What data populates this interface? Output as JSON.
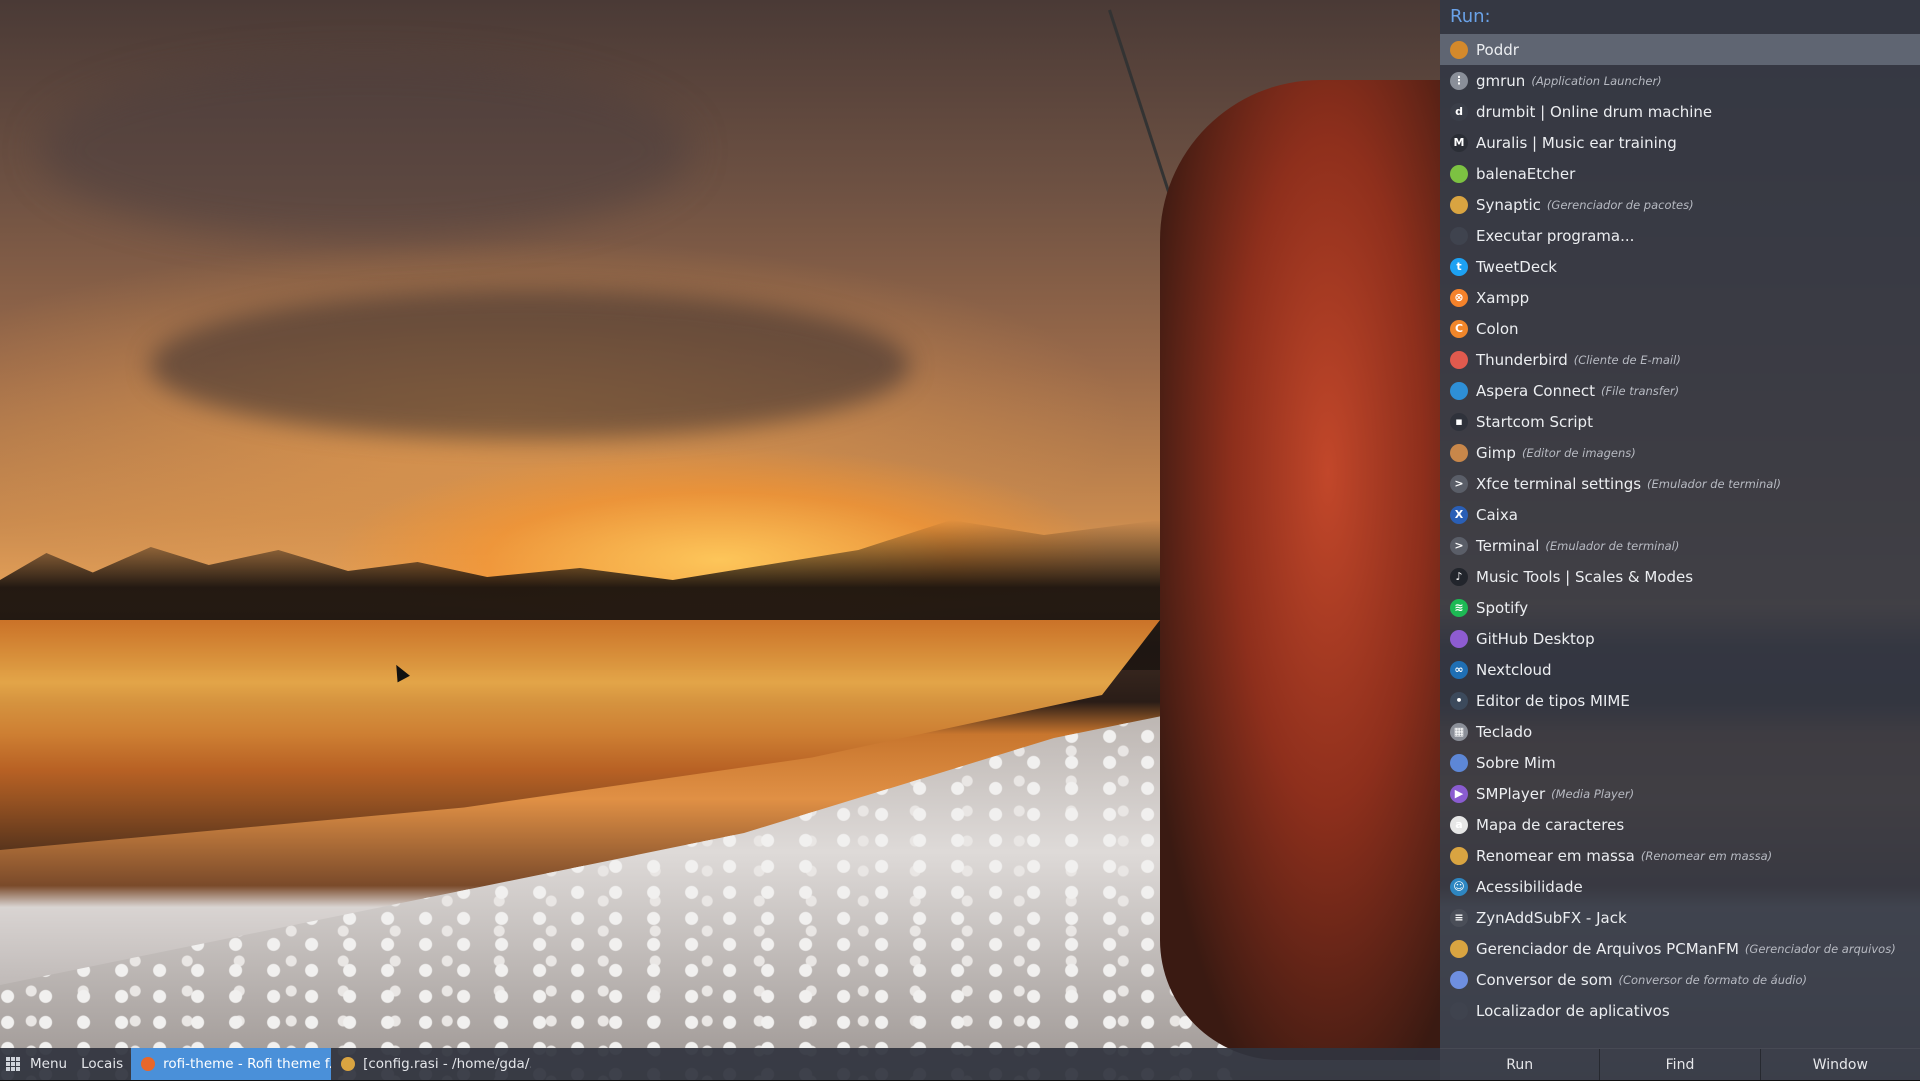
{
  "rofi": {
    "prompt": "Run:",
    "items": [
      {
        "name": "Poddr",
        "desc": "",
        "icon": "poddr-icon",
        "color": "#d4892b",
        "glyph": "",
        "selected": true
      },
      {
        "name": "gmrun",
        "desc": "(Application Launcher)",
        "icon": "grid-app-icon",
        "color": "#8a8f99",
        "glyph": "⋮"
      },
      {
        "name": "drumbit | Online drum machine",
        "desc": "",
        "icon": "drumbit-icon",
        "color": "#3a3e48",
        "glyph": "d"
      },
      {
        "name": "Auralis | Music ear training",
        "desc": "",
        "icon": "auralis-icon",
        "color": "#2b2e36",
        "glyph": "M"
      },
      {
        "name": "balenaEtcher",
        "desc": "",
        "icon": "cube-icon",
        "color": "#7cc242",
        "glyph": ""
      },
      {
        "name": "Synaptic",
        "desc": "(Gerenciador de pacotes)",
        "icon": "synaptic-icon",
        "color": "#d9a441",
        "glyph": ""
      },
      {
        "name": "Executar programa...",
        "desc": "",
        "icon": "run-icon",
        "color": "#3f434e",
        "glyph": ""
      },
      {
        "name": "TweetDeck",
        "desc": "",
        "icon": "tweetdeck-icon",
        "color": "#1da1f2",
        "glyph": "t"
      },
      {
        "name": "Xampp",
        "desc": "",
        "icon": "xampp-icon",
        "color": "#f5822a",
        "glyph": "⊗"
      },
      {
        "name": "Colon",
        "desc": "",
        "icon": "colon-icon",
        "color": "#f0862a",
        "glyph": "C"
      },
      {
        "name": "Thunderbird",
        "desc": "(Cliente de E-mail)",
        "icon": "thunderbird-icon",
        "color": "#e05a4e",
        "glyph": ""
      },
      {
        "name": "Aspera Connect",
        "desc": "(File transfer)",
        "icon": "aspera-icon",
        "color": "#2e8fd6",
        "glyph": ""
      },
      {
        "name": "Startcom Script",
        "desc": "",
        "icon": "script-icon",
        "color": "#2f323b",
        "glyph": "▪"
      },
      {
        "name": "Gimp",
        "desc": "(Editor de imagens)",
        "icon": "gimp-icon",
        "color": "#c8874a",
        "glyph": ""
      },
      {
        "name": "Xfce terminal settings",
        "desc": "(Emulador de terminal)",
        "icon": "terminal-settings-icon",
        "color": "#5a5e68",
        "glyph": ">"
      },
      {
        "name": "Caixa",
        "desc": "",
        "icon": "caixa-icon",
        "color": "#2a5fb6",
        "glyph": "X"
      },
      {
        "name": "Terminal",
        "desc": "(Emulador de terminal)",
        "icon": "terminal-icon",
        "color": "#5a5e68",
        "glyph": ">"
      },
      {
        "name": "Music Tools | Scales & Modes",
        "desc": "",
        "icon": "music-tools-icon",
        "color": "#22252c",
        "glyph": "♪"
      },
      {
        "name": "Spotify",
        "desc": "",
        "icon": "spotify-icon",
        "color": "#1db954",
        "glyph": "≋"
      },
      {
        "name": "GitHub Desktop",
        "desc": "",
        "icon": "github-icon",
        "color": "#8e5cd1",
        "glyph": ""
      },
      {
        "name": "Nextcloud",
        "desc": "",
        "icon": "nextcloud-icon",
        "color": "#1f6fb4",
        "glyph": "∞"
      },
      {
        "name": "Editor de tipos MIME",
        "desc": "",
        "icon": "mime-editor-icon",
        "color": "#3c4a5c",
        "glyph": "•"
      },
      {
        "name": "Teclado",
        "desc": "",
        "icon": "keyboard-icon",
        "color": "#8b8f98",
        "glyph": "▦"
      },
      {
        "name": "Sobre Mim",
        "desc": "",
        "icon": "about-me-icon",
        "color": "#5d87d6",
        "glyph": ""
      },
      {
        "name": "SMPlayer",
        "desc": "(Media Player)",
        "icon": "smplayer-icon",
        "color": "#8a5cd0",
        "glyph": "▶"
      },
      {
        "name": "Mapa de caracteres",
        "desc": "",
        "icon": "charmap-icon",
        "color": "#e6e6e6",
        "glyph": "a"
      },
      {
        "name": "Renomear em massa",
        "desc": "(Renomear em massa)",
        "icon": "bulk-rename-icon",
        "color": "#d9a441",
        "glyph": ""
      },
      {
        "name": "Acessibilidade",
        "desc": "",
        "icon": "accessibility-icon",
        "color": "#2e86c1",
        "glyph": "☺"
      },
      {
        "name": "ZynAddSubFX - Jack",
        "desc": "",
        "icon": "zynaddsubfx-icon",
        "color": "#4a4e58",
        "glyph": "≡"
      },
      {
        "name": "Gerenciador de Arquivos PCManFM",
        "desc": "(Gerenciador de arquivos)",
        "icon": "file-manager-icon",
        "color": "#d9a441",
        "glyph": ""
      },
      {
        "name": "Conversor de som",
        "desc": "(Conversor de formato de áudio)",
        "icon": "sound-converter-icon",
        "color": "#6e8fe0",
        "glyph": ""
      },
      {
        "name": "Localizador de aplicativos",
        "desc": "",
        "icon": "app-finder-icon",
        "color": "#3f434e",
        "glyph": ""
      }
    ],
    "modes": [
      "Run",
      "Find",
      "Window"
    ]
  },
  "taskbar": {
    "menu_label": "Menu",
    "places_label": "Locais",
    "tasks": [
      {
        "label": "rofi-theme - Rofi theme f...",
        "icon": "firefox-icon",
        "color": "#e8672a",
        "active": true
      },
      {
        "label": "[config.rasi - /home/gda/....",
        "icon": "text-editor-icon",
        "color": "#d9a441",
        "active": false
      }
    ]
  }
}
